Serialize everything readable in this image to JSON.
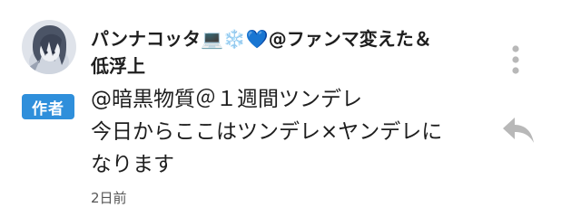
{
  "comment": {
    "author_name": "パンナコッタ",
    "author_emojis": "💻❄️💙",
    "author_suffix_line1": "@ファンマ変えた＆",
    "author_suffix_line2": "低浮上",
    "badge_label": "作者",
    "body_lines": [
      "@暗黒物質＠１週間ツンデレ",
      "今日からここはツンデレ×ヤンデレに",
      "なります"
    ],
    "timestamp": "2日前"
  },
  "icons": {
    "avatar": "avatar-image",
    "menu": "more-vertical-icon",
    "reply": "reply-arrow-icon"
  },
  "colors": {
    "badge_bg": "#2f8fdb",
    "icon_gray": "#b8b8b8",
    "emoji_blue": "#2a7ed6"
  }
}
